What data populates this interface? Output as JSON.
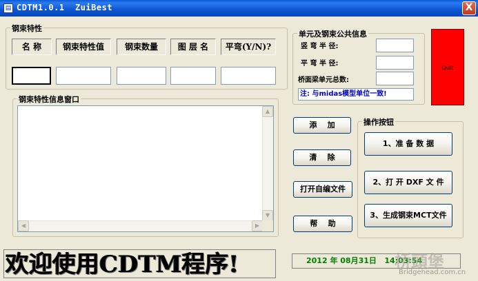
{
  "window": {
    "title": "CDTM1.0.1  ZuiBest",
    "close_label": "X",
    "icon_name": "app-icon"
  },
  "props_group": {
    "title": "钢束特性",
    "headers": [
      "名  称",
      "钢束特性值",
      "钢束数量",
      "图 层 名",
      "平弯(Y/N)?"
    ],
    "values": [
      "",
      "",
      "",
      "",
      ""
    ]
  },
  "common_group": {
    "title": "单元及钢束公共信息",
    "labels": [
      "竖 弯 半 径:",
      "平 弯 半 径:",
      "桥面梁单元总数:"
    ],
    "values": [
      "",
      "",
      ""
    ],
    "note": "注: 与midas模型单位一致!"
  },
  "quit_label": "Quit",
  "quit_color": "#ff0000",
  "info_group": {
    "title": "钢束特性信息窗口",
    "content": ""
  },
  "buttons": {
    "add": "添    加",
    "clear": "清    除",
    "open_help_file": "打开自编文件",
    "help": "帮    助"
  },
  "ops_group": {
    "title": "操作按钮",
    "prepare": "1、准 备 数 据",
    "open_dxf": "2、打 开 DXF 文 件",
    "generate_mct": "3、生成钢束MCT文件"
  },
  "banner": {
    "text": "欢迎使用CDTM程序!"
  },
  "status": {
    "date": "2012 年 08月31日",
    "time": "14:03:54",
    "color": "#008000"
  },
  "watermark": {
    "main": "桥頭堡",
    "sub": "Bridgehead.com.cn"
  }
}
